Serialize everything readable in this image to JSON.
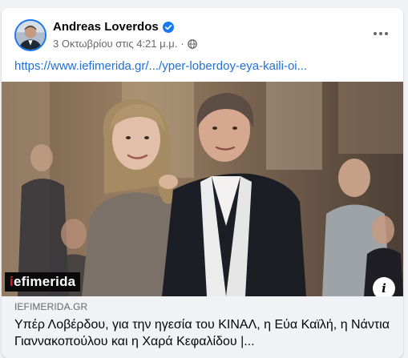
{
  "post": {
    "author": "Andreas Loverdos",
    "timestamp": "3 Οκτωβρίου στις 4:21 μ.μ.",
    "separator": "·",
    "link_text": "https://www.iefimerida.gr/.../yper-loberdoy-eya-kaili-oi...",
    "icons": {
      "verified": "verified-badge-icon",
      "privacy": "globe-icon",
      "more": "more-options-icon",
      "info": "info-icon"
    },
    "colors": {
      "link": "#216fdb",
      "verified": "#1877f2",
      "secondary_text": "#65676b",
      "logo_accent": "#e21f26"
    }
  },
  "preview": {
    "logo_prefix": "i",
    "logo_rest": "efimerida",
    "info_label": "i",
    "domain": "IEFIMERIDA.GR",
    "title": "Υπέρ Λοβέρδου, για την ηγεσία του ΚΙΝΑΛ, η Εύα Καϊλή, η Νάντια Γιαννακοπούλου και η Χαρά Κεφαλίδου |..."
  }
}
